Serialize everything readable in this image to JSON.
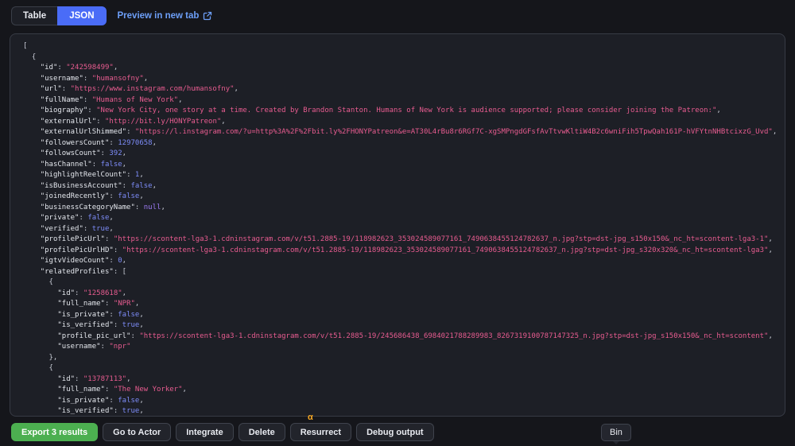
{
  "topbar": {
    "table_tab": "Table",
    "json_tab": "JSON",
    "preview_link": "Preview in new tab"
  },
  "editor": {
    "lines": [
      "[",
      "  {",
      "    \"id\": \"242598499\",",
      "    \"username\": \"humansofny\",",
      "    \"url\": \"https://www.instagram.com/humansofny\",",
      "    \"fullName\": \"Humans of New York\",",
      "    \"biography\": \"New York City, one story at a time. Created by Brandon Stanton. Humans of New York is audience supported; please consider joining the Patreon:\",",
      "    \"externalUrl\": \"http://bit.ly/HONYPatreon\",",
      "    \"externalUrlShimmed\": \"https://l.instagram.com/?u=http%3A%2F%2Fbit.ly%2FHONYPatreon&e=AT30L4rBu8r6RGf7C-xgSMPngdGFsfAvTtvwKltiW4B2c6wniFih5TpwQah161P-hVFYtnNHBtcixzG_Uvd\",",
      "    \"followersCount\": 12970658,",
      "    \"followsCount\": 392,",
      "    \"hasChannel\": false,",
      "    \"highlightReelCount\": 1,",
      "    \"isBusinessAccount\": false,",
      "    \"joinedRecently\": false,",
      "    \"businessCategoryName\": null,",
      "    \"private\": false,",
      "    \"verified\": true,",
      "    \"profilePicUrl\": \"https://scontent-lga3-1.cdninstagram.com/v/t51.2885-19/118982623_353024589077161_7490638455124782637_n.jpg?stp=dst-jpg_s150x150&_nc_ht=scontent-lga3-1\",",
      "    \"profilePicUrlHD\": \"https://scontent-lga3-1.cdninstagram.com/v/t51.2885-19/118982623_353024589077161_7490638455124782637_n.jpg?stp=dst-jpg_s320x320&_nc_ht=scontent-lga3\",",
      "    \"igtvVideoCount\": 0,",
      "    \"relatedProfiles\": [",
      "      {",
      "        \"id\": \"1258618\",",
      "        \"full_name\": \"NPR\",",
      "        \"is_private\": false,",
      "        \"is_verified\": true,",
      "        \"profile_pic_url\": \"https://scontent-lga3-1.cdninstagram.com/v/t51.2885-19/245686438_6984021788289983_8267319100787147325_n.jpg?stp=dst-jpg_s150x150&_nc_ht=scontent\",",
      "        \"username\": \"npr\"",
      "      },",
      "      {",
      "        \"id\": \"13787113\",",
      "        \"full_name\": \"The New Yorker\",",
      "        \"is_private\": false,",
      "        \"is_verified\": true,"
    ]
  },
  "footer": {
    "export_button": "Export 3 results",
    "go_to_actor_button": "Go to Actor",
    "integrate_button": "Integrate",
    "delete_button": "Delete",
    "resurrect_button": "Resurrect",
    "debug_output_button": "Debug output",
    "alpha_badge": "α",
    "bin_tooltip": "Bin"
  },
  "colors": {
    "accent_blue": "#4a6cf7",
    "link_blue": "#6d9ff8",
    "export_green": "#4caf50",
    "string_pink": "#e85c90",
    "number_blue": "#7d8cf8",
    "null_purple": "#9d7bf5",
    "alpha_orange": "#f5a623"
  }
}
